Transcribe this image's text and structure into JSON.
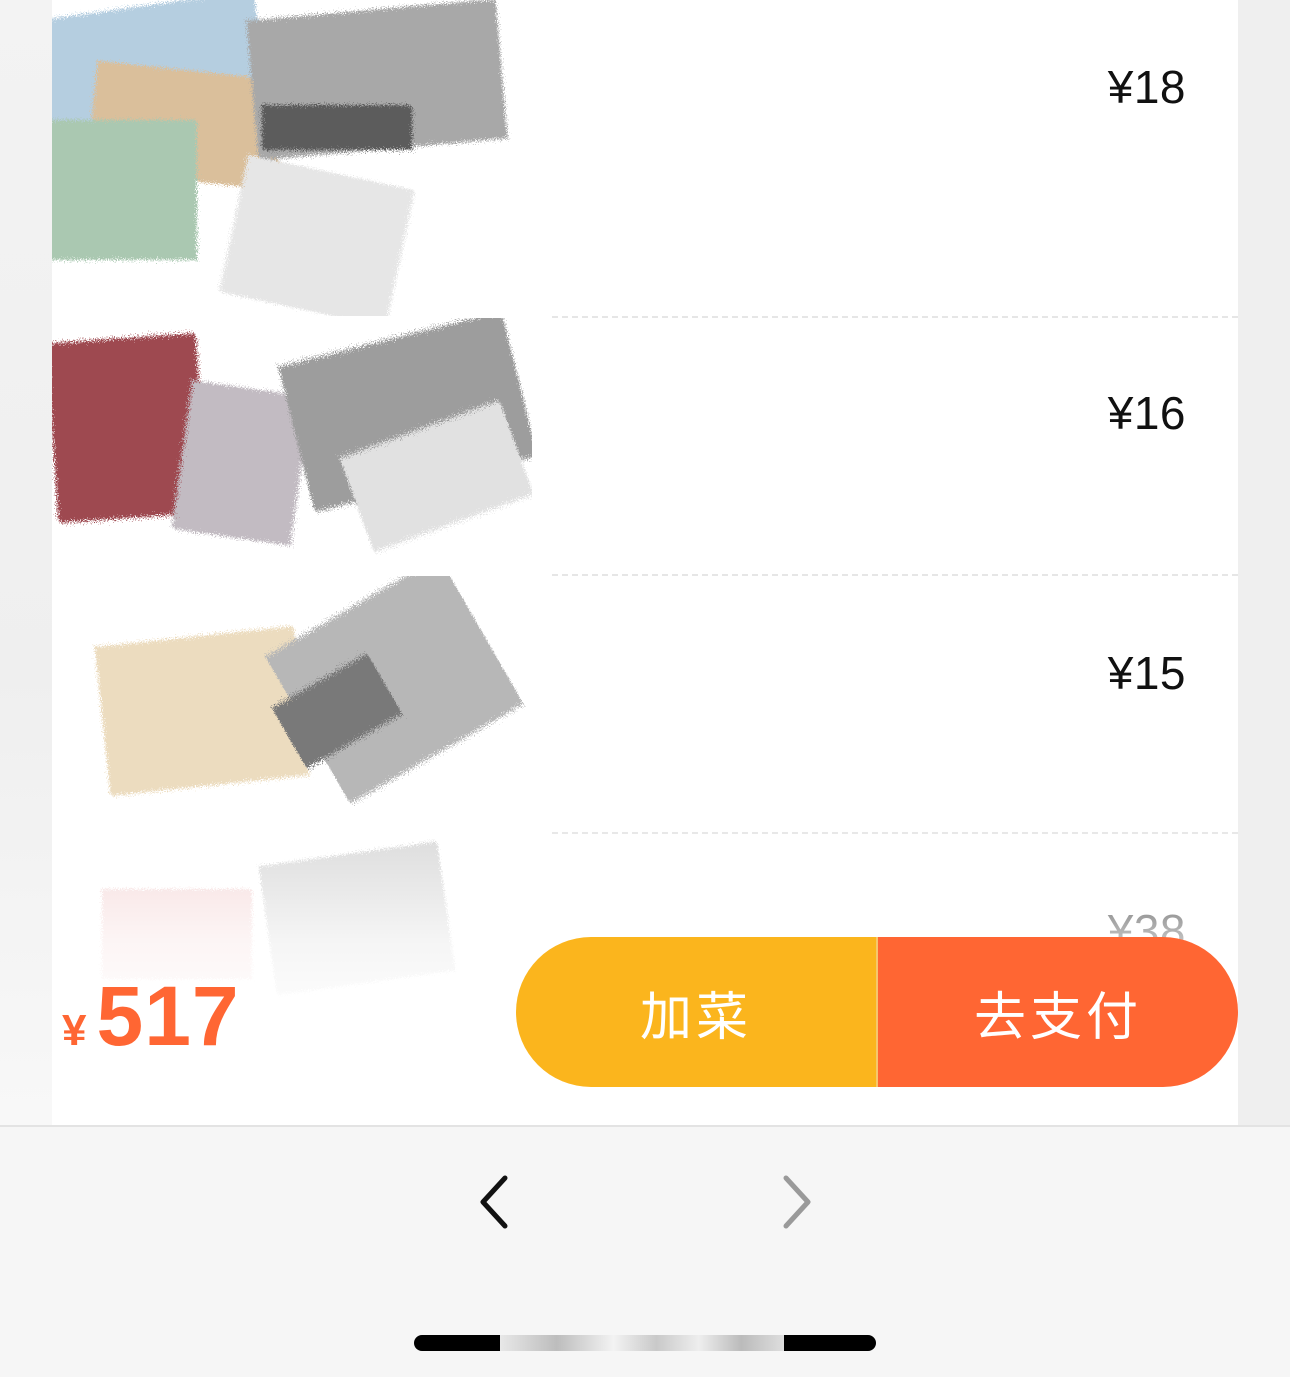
{
  "order_items": [
    {
      "price": "¥18"
    },
    {
      "price": "¥16"
    },
    {
      "price": "¥15"
    },
    {
      "price": "¥38"
    }
  ],
  "checkout": {
    "currency_symbol": "¥",
    "total_amount": "517",
    "add_dish_label": "加菜",
    "pay_label": "去支付"
  },
  "colors": {
    "accent_orange": "#ff6633",
    "add_button_yellow": "#fbb51d"
  },
  "navbar": {
    "back_icon": "chevron-left-icon",
    "forward_icon": "chevron-right-icon"
  }
}
